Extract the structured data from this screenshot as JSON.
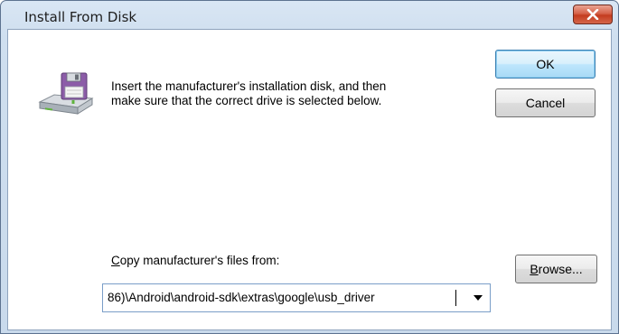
{
  "window": {
    "title": "Install From Disk"
  },
  "message": {
    "line1": "Insert the manufacturer's installation disk, and then",
    "line2": "make sure that the correct drive is selected below."
  },
  "buttons": {
    "ok_label": "OK",
    "cancel_label": "Cancel",
    "browse_first": "B",
    "browse_rest": "rowse..."
  },
  "copy_from": {
    "label_first": "C",
    "label_rest": "opy manufacturer's files from:",
    "value": "86)\\Android\\android-sdk\\extras\\google\\usb_driver"
  },
  "colors": {
    "close_button": "#c9472c",
    "ok_border": "#3c7fb1",
    "disk_purple": "#8c5ca8",
    "disk_drive_green": "#5fb43c"
  },
  "icons": {
    "dialog_icon": "disk-drive-icon",
    "close": "close-icon",
    "dropdown": "chevron-down-icon"
  }
}
